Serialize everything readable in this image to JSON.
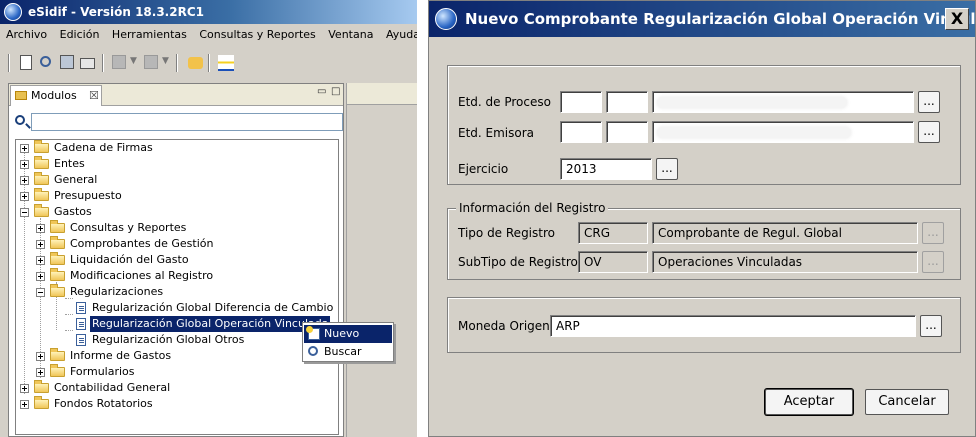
{
  "app_window": {
    "title": "eSidif - Versión 18.3.2RC1",
    "menu": [
      "Archivo",
      "Edición",
      "Herramientas",
      "Consultas y Reportes",
      "Ventana",
      "Ayuda"
    ],
    "view_tab": {
      "label": "Modulos",
      "close": "☒",
      "minimize": "▭",
      "maximize": "□"
    },
    "search": {
      "value": "",
      "placeholder": ""
    },
    "tree": [
      {
        "label": "Cadena de Firmas"
      },
      {
        "label": "Entes"
      },
      {
        "label": "General"
      },
      {
        "label": "Presupuesto"
      },
      {
        "label": "Gastos"
      },
      {
        "label": "Consultas y Reportes"
      },
      {
        "label": "Comprobantes de Gestión"
      },
      {
        "label": "Liquidación del Gasto"
      },
      {
        "label": "Modificaciones al Registro"
      },
      {
        "label": "Regularizaciones"
      },
      {
        "label": "Regularización Global Diferencia de Cambio"
      },
      {
        "label": "Regularización Global Operación Vinculada"
      },
      {
        "label": "Regularización Global Otros"
      },
      {
        "label": "Informe de Gastos"
      },
      {
        "label": "Formularios"
      },
      {
        "label": "Contabilidad General"
      },
      {
        "label": "Fondos Rotatorios"
      }
    ],
    "context_menu": [
      {
        "label": "Nuevo",
        "icon": "new-document-icon"
      },
      {
        "label": "Buscar",
        "icon": "search-icon"
      }
    ]
  },
  "dialog": {
    "title": "Nuevo Comprobante Regularización Global Operación Vincul...",
    "close": "X",
    "etd_proceso": {
      "label": "Etd. de Proceso",
      "button": "..."
    },
    "etd_emisora": {
      "label": "Etd. Emisora",
      "button": "..."
    },
    "ejercicio": {
      "label": "Ejercicio",
      "value": "2013",
      "button": "..."
    },
    "info_registro": {
      "title": "Información del Registro",
      "tipo": {
        "label": "Tipo de Registro",
        "code": "CRG",
        "description": "Comprobante de Regul. Global",
        "button": "..."
      },
      "subtipo": {
        "label": "SubTipo de Registro",
        "code": "OV",
        "description": "Operaciones Vinculadas",
        "button": "..."
      }
    },
    "moneda": {
      "label": "Moneda Origen",
      "value": "ARP",
      "button": "..."
    },
    "buttons": {
      "accept": "Aceptar",
      "cancel": "Cancelar"
    }
  }
}
